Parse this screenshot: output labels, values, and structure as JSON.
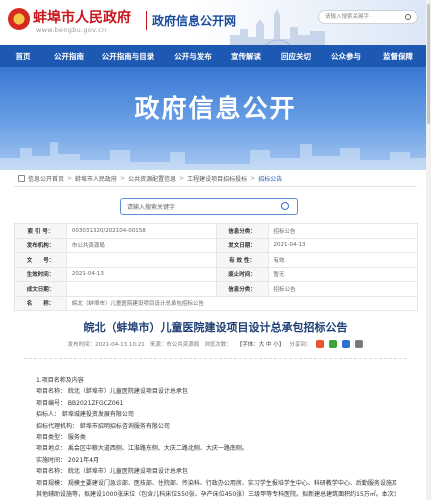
{
  "header": {
    "site_name": "蚌埠市人民政府",
    "site_url": "www.bengbu.gov.cn",
    "subsite_name": "政府信息公开网",
    "search_placeholder": "请输入搜索关键字"
  },
  "nav": [
    "首页",
    "公开指南",
    "公开指南与目录",
    "公开与发布",
    "宣传解读",
    "回应关切",
    "公众参与",
    "监督保障"
  ],
  "banner": {
    "title": "政府信息公开"
  },
  "breadcrumb": [
    "信息公开首页",
    "蚌埠市人民政府",
    "公共资源配置信息",
    "工程建设项目招标投标",
    "招标公告"
  ],
  "search": {
    "placeholder": "请输入搜索关键字"
  },
  "meta": {
    "rows": [
      {
        "k1": "索 引 号：",
        "v1": "003031320/202104-00158",
        "k2": "信息分类：",
        "v2": "招标公告"
      },
      {
        "k1": "发布机构：",
        "v1": "市公共资源局",
        "k2": "发文日期：",
        "v2": "2021-04-13"
      },
      {
        "k1": "文　　号：",
        "v1": "",
        "k2": "有 效 性：",
        "v2": "有效"
      },
      {
        "k1": "生效时间：",
        "v1": "2021-04-13",
        "k2": "废止时间：",
        "v2": "暂无"
      },
      {
        "k1": "成文日期：",
        "v1": "",
        "k2": "信息分类：",
        "v2": "招标公告"
      }
    ],
    "name_label": "名　　称：",
    "name_value": "皖北（蚌埠市）儿童医院建设项目设计总承包招标公告"
  },
  "article": {
    "title": "皖北（蚌埠市）儿童医院建设项目设计总承包招标公告",
    "date": "发布时间：2021-04-13 10:21",
    "source": "来源：市公共资源局",
    "views": "浏览次数：",
    "font_label": "【字体：",
    "font_big": "大",
    "font_mid": "中",
    "font_small": "小",
    "font_end": "】",
    "share_label": "分享到：",
    "paragraphs": [
      "1.项目名称及内容",
      "项目名称：  皖北（蚌埠市）儿童医院建设项目设计总承包",
      "项目编号：  BB2021ZFGCZ061",
      "招标人：  蚌埠城建投资发展有限公司",
      "招标代理机构：  蚌埠市招明招标咨询服务有限公司",
      "项目类型：  服务类",
      "项目地点：  禹会区中粮大道西侧、江淮路东侧、大庆二路北侧、大庆一路南侧。",
      "实施时间：  2021年4月",
      "项目名称：  皖北（蚌埠市）儿童医院建设项目设计总承包",
      "项目规模：  规模主要建设门急诊部、医技部、住院部、传染科、行政办公用房、实习学生报培学生中心、科研教学中心、后勤服务设施及",
      "其他辅助设施等，拟建设1000张床位（包含儿科床位550张、孕产床位450张）三级甲等专科医院。拟新建总建筑面积约15万㎡。本次为设计总承"
    ]
  },
  "colors": {
    "brand_red": "#c8161d",
    "nav_blue": "#1d58b2",
    "title_blue": "#1e3f75"
  }
}
